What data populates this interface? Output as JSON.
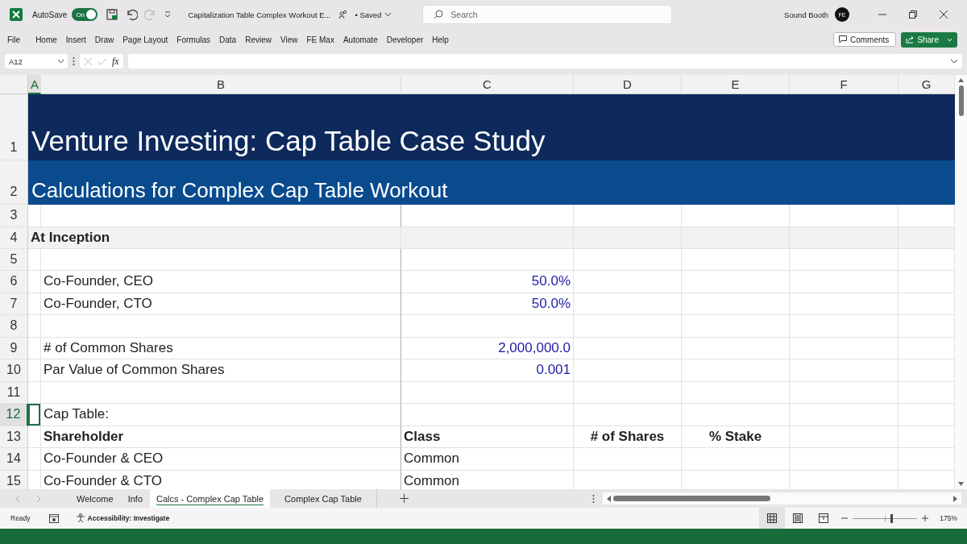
{
  "title_bar": {
    "autosave_label": "AutoSave",
    "autosave": {
      "label": "On",
      "on": true
    },
    "document_title": "Capitalization Table Complex Workout E...",
    "save_status": "• Saved",
    "search": {
      "placeholder": "Search"
    },
    "user_name": "Sound Booth",
    "user_initials": "FE"
  },
  "ribbon": {
    "tabs": [
      {
        "label": "File"
      },
      {
        "label": "Home"
      },
      {
        "label": "Insert"
      },
      {
        "label": "Draw"
      },
      {
        "label": "Page Layout"
      },
      {
        "label": "Formulas"
      },
      {
        "label": "Data"
      },
      {
        "label": "Review"
      },
      {
        "label": "View"
      },
      {
        "label": "FE Max"
      },
      {
        "label": "Automate"
      },
      {
        "label": "Developer"
      },
      {
        "label": "Help"
      }
    ],
    "comments_button": "Comments",
    "share_button": "Share"
  },
  "formula_bar": {
    "name_box": "A12",
    "fx": "fx"
  },
  "columns": [
    {
      "label": "A",
      "selected": true
    },
    {
      "label": "B",
      "selected": false
    },
    {
      "label": "C",
      "selected": false
    },
    {
      "label": "D",
      "selected": false
    },
    {
      "label": "E",
      "selected": false
    },
    {
      "label": "F",
      "selected": false
    },
    {
      "label": "G",
      "selected": false
    }
  ],
  "rows": [
    {
      "number": "1",
      "kind": "title",
      "selected": false,
      "cells": [
        {
          "text": "Venture Investing: Cap Table Case Study",
          "kind": "label"
        }
      ]
    },
    {
      "number": "2",
      "kind": "subtitle",
      "selected": false,
      "cells": [
        {
          "text": "Calculations for Complex Cap Table Workout",
          "kind": "label"
        }
      ]
    },
    {
      "number": "3",
      "kind": "plain",
      "selected": false,
      "cells": []
    },
    {
      "number": "4",
      "kind": "section",
      "selected": false,
      "cells": [
        {
          "text": "At Inception",
          "kind": "header"
        }
      ]
    },
    {
      "number": "5",
      "kind": "plain",
      "selected": false,
      "cells": []
    },
    {
      "number": "6",
      "kind": "plain",
      "selected": false,
      "cells": [
        null,
        {
          "text": "Co-Founder, CEO",
          "kind": "label"
        },
        {
          "text": "50.0%",
          "kind": "input"
        }
      ]
    },
    {
      "number": "7",
      "kind": "plain",
      "selected": false,
      "cells": [
        null,
        {
          "text": "Co-Founder, CTO",
          "kind": "label"
        },
        {
          "text": "50.0%",
          "kind": "input"
        }
      ]
    },
    {
      "number": "8",
      "kind": "plain",
      "selected": false,
      "cells": []
    },
    {
      "number": "9",
      "kind": "plain",
      "selected": false,
      "cells": [
        null,
        {
          "text": "# of Common Shares",
          "kind": "label"
        },
        {
          "text": "2,000,000.0",
          "kind": "input"
        }
      ]
    },
    {
      "number": "10",
      "kind": "plain",
      "selected": false,
      "cells": [
        null,
        {
          "text": "Par Value of Common Shares",
          "kind": "label"
        },
        {
          "text": "0.001",
          "kind": "input"
        }
      ]
    },
    {
      "number": "11",
      "kind": "plain",
      "selected": false,
      "cells": []
    },
    {
      "number": "12",
      "kind": "plain",
      "selected": true,
      "cells": [
        null,
        {
          "text": "Cap Table:",
          "kind": "label"
        }
      ]
    },
    {
      "number": "13",
      "kind": "plain",
      "selected": false,
      "cells": [
        null,
        {
          "text": "Shareholder",
          "kind": "header"
        },
        {
          "text": "Class",
          "kind": "header"
        },
        {
          "text": "# of Shares",
          "kind": "header-center"
        },
        {
          "text": "% Stake",
          "kind": "header-center"
        }
      ]
    },
    {
      "number": "14",
      "kind": "plain",
      "selected": false,
      "cells": [
        null,
        {
          "text": "Co-Founder & CEO",
          "kind": "label"
        },
        {
          "text": "Common",
          "kind": "label"
        }
      ]
    },
    {
      "number": "15",
      "kind": "plain",
      "selected": false,
      "cells": [
        null,
        {
          "text": "Co-Founder & CTO",
          "kind": "label"
        },
        {
          "text": "Common",
          "kind": "label"
        }
      ]
    }
  ],
  "sheet_tabs": [
    {
      "label": "Welcome",
      "selected": false
    },
    {
      "label": "Info",
      "selected": false
    },
    {
      "label": "Calcs - Complex Cap Table",
      "selected": true
    },
    {
      "label": "Complex Cap Table",
      "selected": false
    }
  ],
  "status_bar": {
    "status": "Ready",
    "accessibility": "Accessibility: Investigate",
    "views": [
      {
        "kind": "normal",
        "selected": true
      },
      {
        "kind": "page-layout",
        "selected": false
      },
      {
        "kind": "page-break",
        "selected": false
      }
    ],
    "zoom": {
      "level": 0.6,
      "reading": "175%"
    }
  }
}
